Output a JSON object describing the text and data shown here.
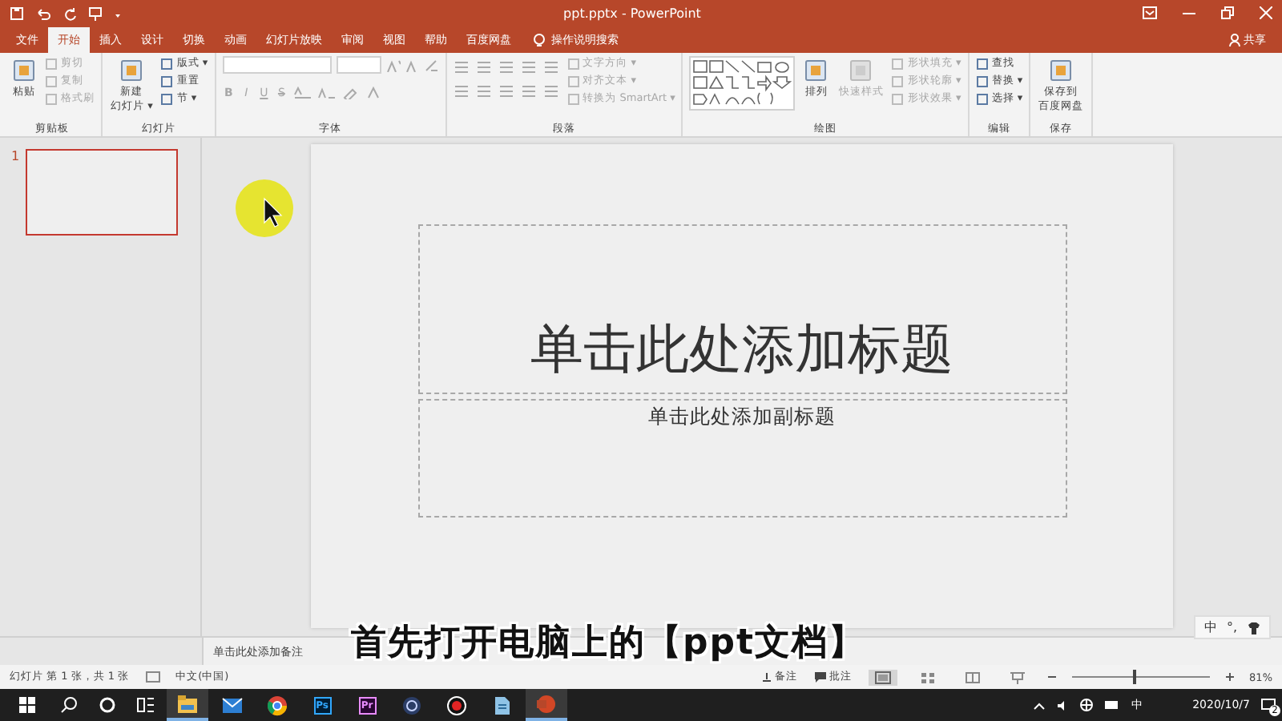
{
  "window": {
    "title": "ppt.pptx - PowerPoint"
  },
  "tabs": [
    {
      "label": "文件",
      "selected": false
    },
    {
      "label": "开始",
      "selected": true
    },
    {
      "label": "插入",
      "selected": false
    },
    {
      "label": "设计",
      "selected": false
    },
    {
      "label": "切换",
      "selected": false
    },
    {
      "label": "动画",
      "selected": false
    },
    {
      "label": "幻灯片放映",
      "selected": false
    },
    {
      "label": "审阅",
      "selected": false
    },
    {
      "label": "视图",
      "selected": false
    },
    {
      "label": "帮助",
      "selected": false
    },
    {
      "label": "百度网盘",
      "selected": false
    }
  ],
  "tell_me": {
    "placeholder": "操作说明搜索"
  },
  "share": "共享",
  "ribbon": {
    "groups": [
      {
        "label": "剪贴板",
        "controls": [
          {
            "kind": "large",
            "lines": [
              "粘贴"
            ],
            "disabled": false
          },
          {
            "kind": "stack",
            "items": [
              {
                "label": "剪切",
                "disabled": true
              },
              {
                "label": "复制",
                "disabled": true
              },
              {
                "label": "格式刷",
                "disabled": true
              }
            ]
          }
        ]
      },
      {
        "label": "幻灯片",
        "controls": [
          {
            "kind": "large",
            "lines": [
              "新建",
              "幻灯片 ▾"
            ],
            "disabled": false
          },
          {
            "kind": "stack",
            "items": [
              {
                "label": "版式 ▾",
                "disabled": false
              },
              {
                "label": "重置",
                "disabled": false
              },
              {
                "label": "节 ▾",
                "disabled": false
              }
            ]
          }
        ]
      },
      {
        "label": "字体",
        "controls": [
          {
            "kind": "font",
            "glyphs": [
              "B",
              "I",
              "U",
              "S"
            ]
          }
        ]
      },
      {
        "label": "段落",
        "controls": [
          {
            "kind": "paragraph"
          },
          {
            "kind": "stack",
            "items": [
              {
                "label": "文字方向 ▾",
                "disabled": true
              },
              {
                "label": "对齐文本 ▾",
                "disabled": true
              },
              {
                "label": "转换为 SmartArt ▾",
                "disabled": true
              }
            ]
          }
        ]
      },
      {
        "label": "绘图",
        "controls": [
          {
            "kind": "shapes"
          },
          {
            "kind": "large",
            "lines": [
              "排列"
            ],
            "disabled": false
          },
          {
            "kind": "large",
            "lines": [
              "快速样式"
            ],
            "disabled": true
          },
          {
            "kind": "stack",
            "items": [
              {
                "label": "形状填充 ▾",
                "disabled": true
              },
              {
                "label": "形状轮廓 ▾",
                "disabled": true
              },
              {
                "label": "形状效果 ▾",
                "disabled": true
              }
            ]
          }
        ]
      },
      {
        "label": "编辑",
        "controls": [
          {
            "kind": "stack",
            "items": [
              {
                "label": "查找",
                "disabled": false
              },
              {
                "label": "替换 ▾",
                "disabled": false
              },
              {
                "label": "选择 ▾",
                "disabled": false
              }
            ]
          }
        ]
      },
      {
        "label": "保存",
        "controls": [
          {
            "kind": "large",
            "lines": [
              "保存到",
              "百度网盘"
            ],
            "disabled": false
          }
        ]
      }
    ]
  },
  "thumbnails": [
    {
      "number": "1",
      "selected": true
    }
  ],
  "slide": {
    "title_placeholder": "单击此处添加标题",
    "subtitle_placeholder": "单击此处添加副标题"
  },
  "notes": {
    "placeholder": "单击此处添加备注"
  },
  "caption": "首先打开电脑上的【ppt文档】",
  "ime_bar": {
    "mode": "中",
    "punctuation": "°,"
  },
  "status_bar": {
    "slide_info": "幻灯片 第 1 张，共 1 张",
    "language": "中文(中国)",
    "notes": "备注",
    "comments": "批注",
    "zoom": "81%",
    "zoom_slider": {
      "level": 0.45
    },
    "views": [
      {
        "kind": "normal",
        "selected": true
      },
      {
        "kind": "sorter",
        "selected": false
      },
      {
        "kind": "reading",
        "selected": false
      },
      {
        "kind": "show",
        "selected": false
      }
    ]
  },
  "taskbar": {
    "apps": [
      {
        "kind": "folder",
        "running": true
      },
      {
        "kind": "mail",
        "running": false
      },
      {
        "kind": "browser",
        "running": false
      },
      {
        "kind": "tile",
        "label": "Ps",
        "running": false
      },
      {
        "kind": "tile",
        "label": "Pr",
        "running": false
      },
      {
        "kind": "orb",
        "running": false
      },
      {
        "kind": "record",
        "running": false
      },
      {
        "kind": "doc",
        "running": false
      },
      {
        "kind": "ppt",
        "running": true
      }
    ],
    "ime": "中",
    "date": "2020/10/7",
    "notifications": "2"
  }
}
